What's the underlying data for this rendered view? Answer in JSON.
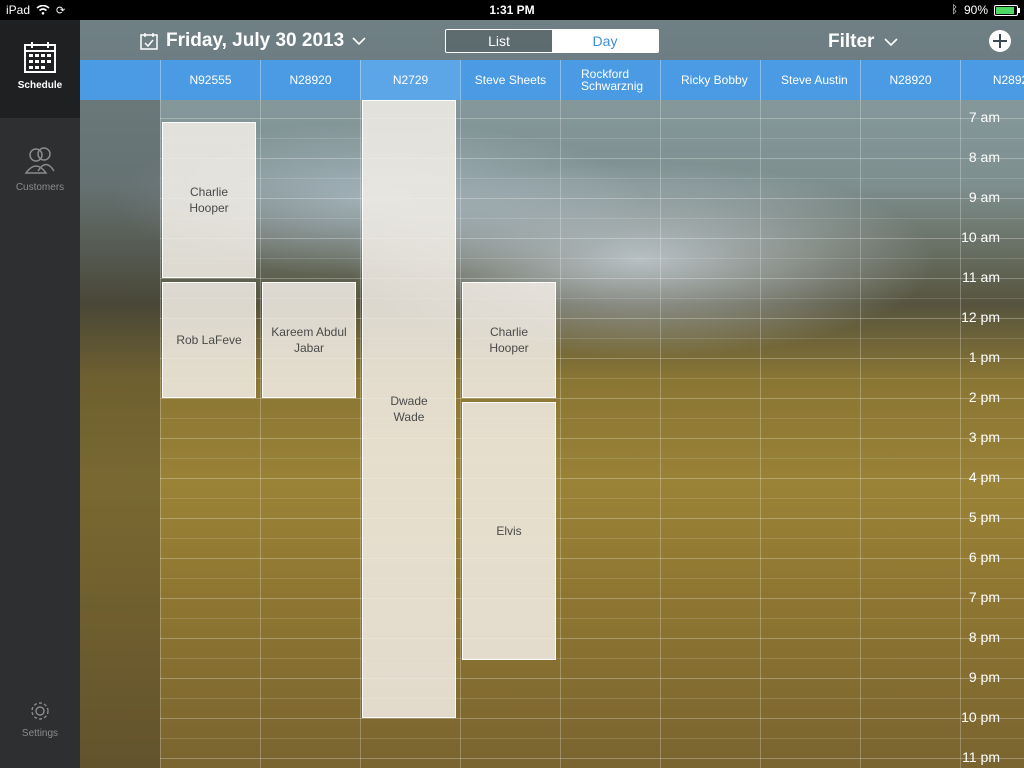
{
  "status_bar": {
    "device": "iPad",
    "time": "1:31 PM",
    "battery": "90%"
  },
  "sidebar": {
    "items": [
      {
        "label": "Schedule",
        "icon": "calendar-icon",
        "active": true
      },
      {
        "label": "Customers",
        "icon": "customers-icon",
        "active": false
      },
      {
        "label": "Settings",
        "icon": "gear-icon",
        "active": false
      }
    ]
  },
  "header": {
    "date": "Friday, July 30 2013",
    "view_options": [
      "List",
      "Day"
    ],
    "selected_view": "Day",
    "filter_label": "Filter"
  },
  "columns": [
    "N92555",
    "N28920",
    "N2729",
    "Steve Sheets",
    "Rockford Schwarznig",
    "Ricky Bobby",
    "Steve Austin",
    "N28920",
    "N2892"
  ],
  "times": [
    "7 am",
    "8 am",
    "9 am",
    "10 am",
    "11 am",
    "12 pm",
    "1 pm",
    "2 pm",
    "3 pm",
    "4 pm",
    "5 pm",
    "6 pm",
    "7 pm",
    "8 pm",
    "9 pm",
    "10 pm",
    "11 pm"
  ],
  "appointments": [
    {
      "name": "Charlie Hooper"
    },
    {
      "name": "Rob LaFeve"
    },
    {
      "name": "Kareem Abdul Jabar"
    },
    {
      "name": "Dwade Wade"
    },
    {
      "name": "Charlie Hooper"
    },
    {
      "name": "Elvis"
    }
  ],
  "colors": {
    "accent": "#4a9be4",
    "sidebar": "#2e2f31",
    "active_tab_text": "#3d8fd8"
  }
}
